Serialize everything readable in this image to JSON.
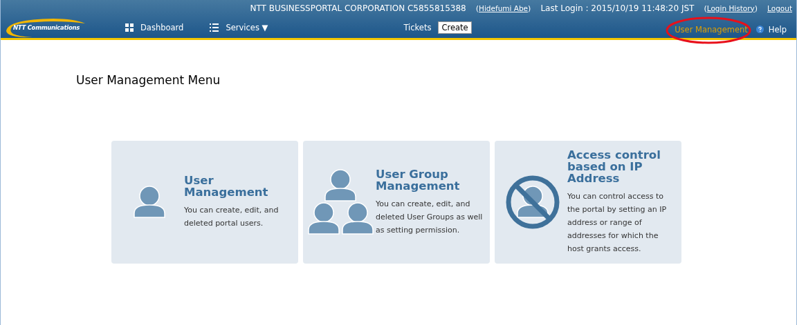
{
  "header": {
    "logo": "NTT Communications",
    "company": "NTT BUSINESSPORTAL CORPORATION C5855815388",
    "user": "Hidefumi Abe",
    "last_login": "Last Login : 2015/10/19 11:48:20 JST",
    "login_history": "Login History",
    "logout": "Logout",
    "brackets": [
      "(",
      ")"
    ]
  },
  "nav": {
    "left": [
      {
        "label": "Dashboard",
        "kind": "grid"
      },
      {
        "label": "Services ▼",
        "kind": "list"
      }
    ],
    "tickets": {
      "label": "Tickets",
      "button": "Create"
    },
    "right": [
      {
        "label": "User Management",
        "selected": true,
        "highlighted": true,
        "kind": "link"
      },
      {
        "label": "Help",
        "selected": false,
        "highlighted": false,
        "kind": "help"
      }
    ]
  },
  "page_title": "User Management Menu",
  "cards": [
    {
      "kind": "user",
      "title": "User Management",
      "text": "You can create, edit, and deleted portal users."
    },
    {
      "kind": "group",
      "title": "User Group Management",
      "text": "You can create, edit, and deleted User Groups as well as setting permission."
    },
    {
      "kind": "blocked",
      "title": "Access control based on IP Address",
      "text": "You can control access to the portal by setting an IP address or range of addresses for which the host grants access."
    }
  ]
}
